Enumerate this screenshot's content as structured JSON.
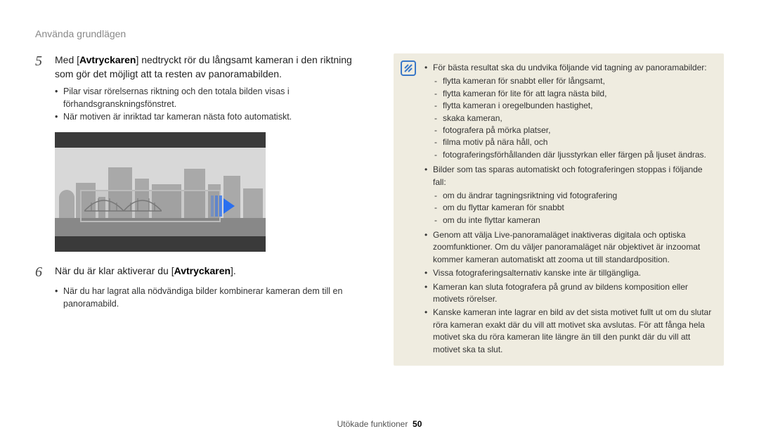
{
  "header": "Använda grundlägen",
  "step5": {
    "num": "5",
    "text_before": "Med [",
    "bold1": "Avtryckaren",
    "text_after": "] nedtryckt rör du långsamt kameran i den riktning som gör det möjligt att ta resten av panoramabilden.",
    "sub": [
      "Pilar visar rörelsernas riktning och den totala bilden visas i förhandsgranskningsfönstret.",
      "När motiven är inriktad tar kameran nästa foto automatiskt."
    ]
  },
  "step6": {
    "num": "6",
    "text_before": "När du är klar aktiverar du [",
    "bold1": "Avtryckaren",
    "text_after": "].",
    "sub": [
      "När du har lagrat alla nödvändiga bilder kombinerar kameran dem till en panoramabild."
    ]
  },
  "note": {
    "b1": "För bästa resultat ska du undvika följande vid tagning av panoramabilder:",
    "b1_sub": [
      "flytta kameran för snabbt eller för långsamt,",
      "flytta kameran för lite för att lagra nästa bild,",
      "flytta kameran i oregelbunden hastighet,",
      "skaka kameran,",
      "fotografera på mörka platser,",
      "filma motiv på nära håll, och",
      "fotograferingsförhållanden där ljusstyrkan eller färgen på ljuset ändras."
    ],
    "b2": "Bilder som tas sparas automatiskt och fotograferingen stoppas i följande fall:",
    "b2_sub": [
      "om du ändrar tagningsriktning vid fotografering",
      "om du flyttar kameran för snabbt",
      "om du inte flyttar kameran"
    ],
    "b3": "Genom att välja Live-panoramaläget inaktiveras digitala och optiska zoomfunktioner. Om du väljer panoramaläget när objektivet är inzoomat kommer kameran automatiskt att zooma ut till standardposition.",
    "b4": "Vissa fotograferingsalternativ kanske inte är tillgängliga.",
    "b5": "Kameran kan sluta fotografera på grund av bildens komposition eller motivets rörelser.",
    "b6": "Kanske kameran inte lagrar en bild av det sista motivet fullt ut om du slutar röra kameran exakt där du vill att motivet ska avslutas. För att fånga hela motivet ska du röra kameran lite längre än till den punkt där du vill att motivet ska ta slut."
  },
  "footer": {
    "label": "Utökade funktioner",
    "page": "50"
  }
}
